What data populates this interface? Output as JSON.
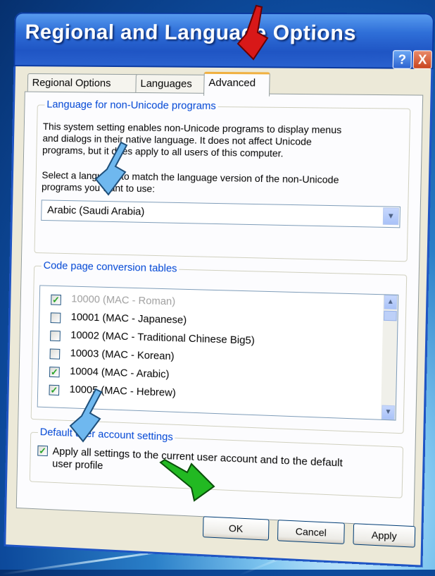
{
  "window": {
    "title": "Regional and Language Options",
    "help_label": "?",
    "close_label": "X"
  },
  "tabs": [
    {
      "label": "Regional Options"
    },
    {
      "label": "Languages"
    },
    {
      "label": "Advanced"
    }
  ],
  "non_unicode": {
    "group_title": "Language for non-Unicode programs",
    "description_lines": [
      "This system setting enables non-Unicode programs to display menus",
      "and dialogs in their native language. It does not affect Unicode",
      "programs, but it does apply to all users of this computer."
    ],
    "select_prompt_lines": [
      "Select a language to match the language version of the non-Unicode",
      "programs you want to use:"
    ],
    "selected_language": "Arabic (Saudi Arabia)"
  },
  "code_page": {
    "group_title": "Code page conversion tables",
    "items": [
      {
        "label": "10000 (MAC - Roman)",
        "checked": true,
        "disabled": true
      },
      {
        "label": "10001 (MAC - Japanese)",
        "checked": false,
        "disabled": false
      },
      {
        "label": "10002 (MAC - Traditional Chinese Big5)",
        "checked": false,
        "disabled": false
      },
      {
        "label": "10003 (MAC - Korean)",
        "checked": false,
        "disabled": false
      },
      {
        "label": "10004 (MAC - Arabic)",
        "checked": true,
        "disabled": false
      },
      {
        "label": "10005 (MAC - Hebrew)",
        "checked": true,
        "disabled": false
      }
    ]
  },
  "default_user": {
    "group_title": "Default user account settings",
    "apply_lines": [
      "Apply all settings to the current user account and to the default",
      "user profile"
    ],
    "apply_checked": true
  },
  "buttons": {
    "ok": "OK",
    "cancel": "Cancel",
    "apply": "Apply"
  },
  "check_mark": "✓",
  "colors": {
    "red_pointer": "#d81818",
    "blue_pointer": "#6fb8ef",
    "green_pointer": "#22b922",
    "group_title": "#0046d5"
  }
}
